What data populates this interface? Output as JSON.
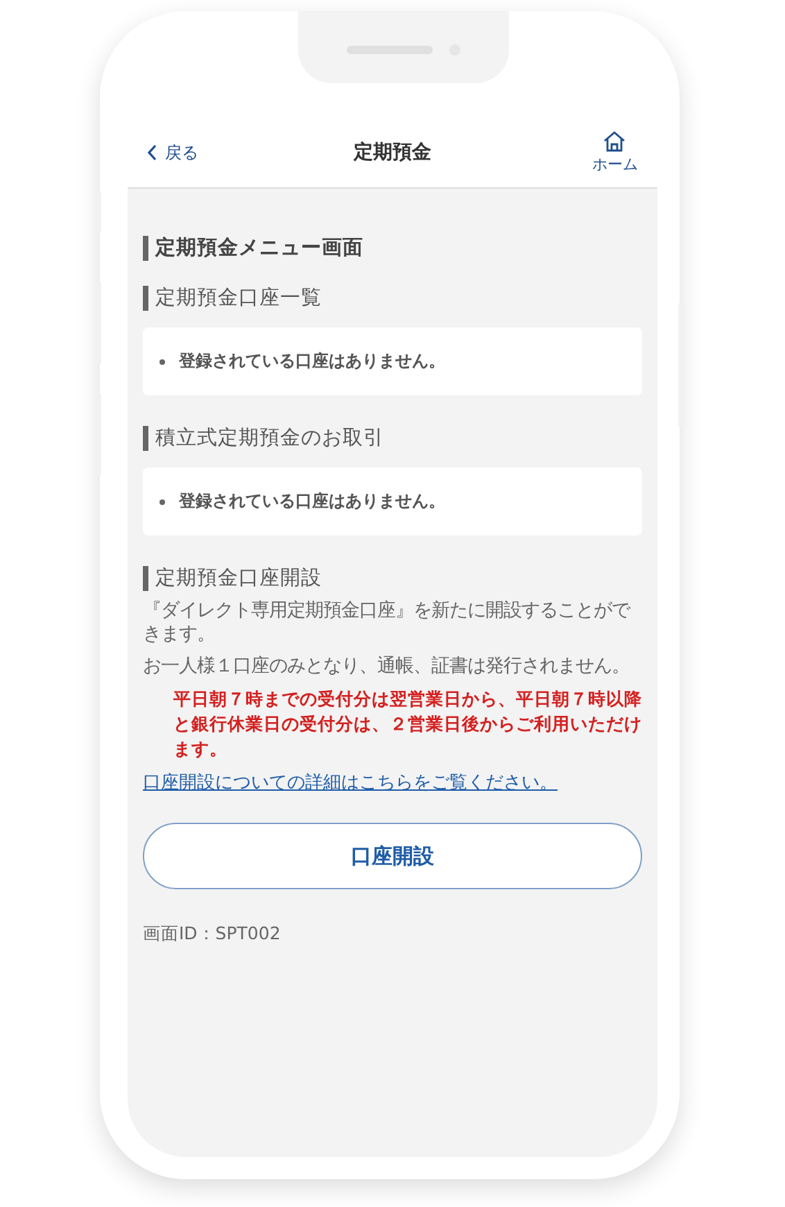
{
  "header": {
    "back": "戻る",
    "title": "定期預金",
    "home": "ホーム"
  },
  "page_title": "定期預金メニュー画面",
  "sections": [
    {
      "heading": "定期預金口座一覧",
      "items": [
        "登録されている口座はありません。"
      ]
    },
    {
      "heading": "積立式定期預金のお取引",
      "items": [
        "登録されている口座はありません。"
      ]
    }
  ],
  "opening": {
    "heading": "定期預金口座開設",
    "paragraphs": [
      "『ダイレクト専用定期預金口座』を新たに開設することができます。",
      "お一人様１口座のみとなり、通帳、証書は発行されません。"
    ],
    "notice": "平日朝７時までの受付分は翌営業日から、平日朝７時以降と銀行休業日の受付分は、２営業日後からご利用いただけます。",
    "link": "口座開設についての詳細はこちらをご覧ください。",
    "button": "口座開設"
  },
  "screen_id": "画面ID：SPT002"
}
